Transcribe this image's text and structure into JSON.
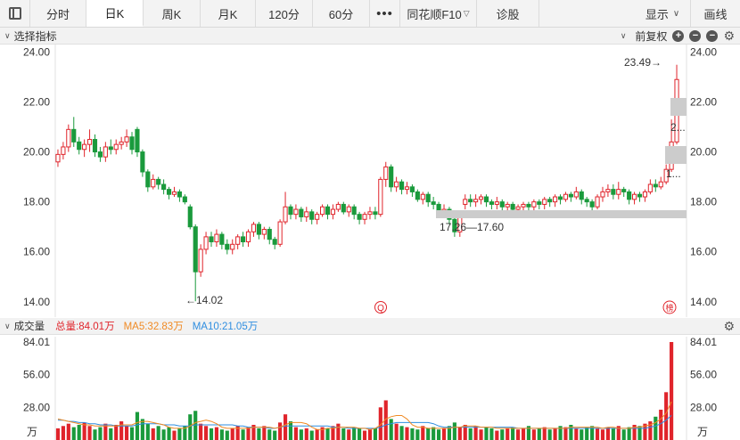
{
  "toolbar": {
    "tabs": [
      "分时",
      "日K",
      "周K",
      "月K",
      "120分",
      "60分"
    ],
    "active_tab": "日K",
    "more": "•••",
    "f10": "同花顺F10",
    "diagnose": "诊股",
    "display": "显示",
    "draw": "画线"
  },
  "indicator_bar": {
    "label": "选择指标",
    "adjust": "前复权"
  },
  "volume_bar": {
    "label": "成交量",
    "total": "总量:84.01万",
    "ma5": "MA5:32.83万",
    "ma10": "MA10:21.05万"
  },
  "colors": {
    "up": "#e0242b",
    "down": "#1a9a3c",
    "ma5": "#f08a24",
    "ma10": "#2f8ee0",
    "band": "#cccccc"
  },
  "annotations": {
    "high": "23.49→",
    "low": "←14.02",
    "range": "17.26—17.60",
    "band_a": "2...",
    "band_b": "1...",
    "marker_q": "Q",
    "marker_bang": "榜"
  },
  "chart_data": {
    "type": "candlestick",
    "price_axis": {
      "ticks": [
        "24.00",
        "22.00",
        "20.00",
        "18.00",
        "16.00",
        "14.00"
      ],
      "range": [
        13.6,
        24.3
      ]
    },
    "volume_axis": {
      "ticks": [
        "84.01",
        "56.00",
        "28.00"
      ],
      "unit": "万",
      "range": [
        0,
        84.01
      ]
    },
    "candles": [
      [
        19.6,
        19.9,
        19.4,
        20.1
      ],
      [
        19.9,
        20.2,
        19.7,
        20.4
      ],
      [
        20.2,
        20.9,
        20.0,
        21.1
      ],
      [
        20.9,
        20.4,
        20.2,
        21.4
      ],
      [
        20.4,
        20.1,
        19.9,
        20.6
      ],
      [
        20.1,
        20.3,
        19.8,
        20.5
      ],
      [
        20.3,
        20.5,
        20.0,
        20.9
      ],
      [
        20.5,
        20.0,
        19.8,
        20.7
      ],
      [
        20.0,
        19.8,
        19.6,
        20.2
      ],
      [
        19.8,
        20.2,
        19.6,
        20.4
      ],
      [
        20.2,
        20.1,
        19.9,
        20.5
      ],
      [
        20.1,
        20.3,
        19.9,
        20.5
      ],
      [
        20.3,
        20.4,
        20.1,
        20.6
      ],
      [
        20.4,
        20.6,
        20.2,
        20.9
      ],
      [
        20.6,
        20.1,
        19.9,
        20.8
      ],
      [
        20.9,
        20.0,
        19.8,
        21.0
      ],
      [
        20.0,
        19.2,
        19.0,
        20.1
      ],
      [
        19.2,
        18.6,
        18.4,
        19.3
      ],
      [
        18.6,
        18.9,
        18.5,
        19.1
      ],
      [
        18.9,
        18.7,
        18.5,
        19.0
      ],
      [
        18.7,
        18.5,
        18.3,
        18.9
      ],
      [
        18.5,
        18.3,
        18.1,
        18.6
      ],
      [
        18.3,
        18.4,
        18.2,
        18.6
      ],
      [
        18.4,
        18.2,
        18.0,
        18.5
      ],
      [
        18.2,
        18.0,
        17.9,
        18.3
      ],
      [
        17.8,
        17.0,
        16.9,
        17.9
      ],
      [
        17.0,
        15.2,
        14.02,
        17.1
      ],
      [
        15.2,
        16.1,
        15.0,
        16.3
      ],
      [
        16.1,
        16.6,
        15.9,
        16.8
      ],
      [
        16.6,
        16.4,
        16.2,
        16.8
      ],
      [
        16.4,
        16.7,
        16.2,
        16.9
      ],
      [
        16.7,
        16.3,
        16.1,
        16.8
      ],
      [
        16.3,
        16.1,
        15.9,
        16.5
      ],
      [
        16.1,
        16.3,
        15.9,
        16.5
      ],
      [
        16.3,
        16.6,
        16.1,
        16.7
      ],
      [
        16.6,
        16.4,
        16.2,
        16.8
      ],
      [
        16.4,
        16.8,
        16.2,
        16.9
      ],
      [
        16.8,
        17.1,
        16.6,
        17.2
      ],
      [
        17.1,
        16.7,
        16.5,
        17.2
      ],
      [
        16.7,
        16.9,
        16.5,
        17.0
      ],
      [
        16.9,
        16.5,
        16.3,
        17.0
      ],
      [
        16.5,
        16.3,
        16.1,
        16.6
      ],
      [
        16.3,
        17.2,
        16.2,
        17.3
      ],
      [
        17.2,
        17.8,
        17.1,
        18.4
      ],
      [
        17.8,
        17.5,
        17.3,
        17.9
      ],
      [
        17.5,
        17.7,
        17.3,
        17.9
      ],
      [
        17.7,
        17.4,
        17.2,
        17.8
      ],
      [
        17.4,
        17.6,
        17.2,
        17.8
      ],
      [
        17.6,
        17.3,
        17.1,
        17.7
      ],
      [
        17.3,
        17.5,
        17.1,
        17.6
      ],
      [
        17.5,
        17.8,
        17.4,
        17.9
      ],
      [
        17.8,
        17.5,
        17.3,
        17.9
      ],
      [
        17.5,
        17.7,
        17.3,
        17.9
      ],
      [
        17.7,
        17.9,
        17.6,
        18.0
      ],
      [
        17.9,
        17.6,
        17.5,
        18.0
      ],
      [
        17.6,
        17.8,
        17.4,
        17.9
      ],
      [
        17.8,
        17.5,
        17.3,
        17.9
      ],
      [
        17.5,
        17.3,
        17.1,
        17.6
      ],
      [
        17.3,
        17.5,
        17.1,
        17.6
      ],
      [
        17.5,
        17.6,
        17.3,
        17.8
      ],
      [
        17.6,
        17.5,
        17.3,
        17.8
      ],
      [
        17.5,
        18.9,
        17.4,
        19.0
      ],
      [
        18.9,
        19.4,
        18.6,
        19.6
      ],
      [
        19.4,
        18.6,
        18.4,
        19.5
      ],
      [
        18.6,
        18.8,
        18.4,
        19.0
      ],
      [
        18.8,
        18.5,
        18.3,
        18.9
      ],
      [
        18.5,
        18.6,
        18.3,
        18.8
      ],
      [
        18.6,
        18.4,
        18.2,
        18.7
      ],
      [
        18.4,
        18.1,
        18.0,
        18.5
      ],
      [
        18.1,
        18.3,
        17.9,
        18.4
      ],
      [
        18.3,
        18.0,
        17.8,
        18.4
      ],
      [
        18.0,
        17.9,
        17.7,
        18.2
      ],
      [
        17.9,
        17.6,
        17.4,
        18.0
      ],
      [
        17.6,
        17.7,
        17.4,
        17.9
      ],
      [
        17.7,
        17.3,
        17.1,
        17.8
      ],
      [
        17.3,
        16.8,
        16.6,
        17.4
      ],
      [
        16.8,
        17.4,
        16.6,
        17.6
      ],
      [
        17.9,
        18.1,
        17.7,
        18.3
      ],
      [
        18.1,
        18.0,
        17.8,
        18.3
      ],
      [
        18.0,
        18.1,
        17.8,
        18.3
      ],
      [
        18.1,
        18.2,
        17.9,
        18.3
      ],
      [
        18.2,
        18.0,
        17.8,
        18.3
      ],
      [
        18.0,
        17.9,
        17.7,
        18.1
      ],
      [
        17.9,
        18.0,
        17.7,
        18.2
      ],
      [
        18.0,
        17.8,
        17.6,
        18.1
      ],
      [
        17.8,
        17.9,
        17.6,
        18.0
      ],
      [
        17.9,
        17.7,
        17.5,
        18.0
      ],
      [
        17.7,
        17.8,
        17.5,
        17.9
      ],
      [
        17.8,
        17.9,
        17.6,
        18.0
      ],
      [
        17.9,
        17.8,
        17.6,
        18.0
      ],
      [
        17.8,
        18.0,
        17.6,
        18.1
      ],
      [
        18.0,
        17.9,
        17.7,
        18.1
      ],
      [
        17.9,
        18.1,
        17.7,
        18.2
      ],
      [
        18.1,
        18.0,
        17.8,
        18.2
      ],
      [
        18.0,
        18.2,
        17.8,
        18.3
      ],
      [
        18.2,
        18.1,
        17.9,
        18.3
      ],
      [
        18.1,
        18.3,
        18.0,
        18.4
      ],
      [
        18.3,
        18.2,
        18.0,
        18.4
      ],
      [
        18.2,
        18.4,
        18.1,
        18.6
      ],
      [
        18.4,
        18.1,
        17.9,
        18.5
      ],
      [
        18.1,
        18.0,
        17.8,
        18.2
      ],
      [
        18.0,
        17.8,
        17.6,
        18.1
      ],
      [
        17.8,
        18.2,
        17.7,
        18.3
      ],
      [
        18.2,
        18.4,
        18.0,
        18.6
      ],
      [
        18.4,
        18.5,
        18.2,
        18.7
      ],
      [
        18.5,
        18.3,
        18.1,
        18.7
      ],
      [
        18.3,
        18.5,
        18.1,
        18.8
      ],
      [
        18.5,
        18.4,
        18.2,
        18.6
      ],
      [
        18.4,
        18.1,
        17.9,
        18.5
      ],
      [
        18.1,
        18.3,
        17.9,
        18.4
      ],
      [
        18.3,
        18.2,
        18.0,
        18.4
      ],
      [
        18.2,
        18.4,
        18.0,
        18.5
      ],
      [
        18.4,
        18.7,
        18.3,
        18.9
      ],
      [
        18.7,
        18.6,
        18.4,
        18.9
      ],
      [
        18.6,
        18.8,
        18.5,
        19.0
      ],
      [
        18.8,
        19.3,
        18.7,
        19.5
      ],
      [
        19.3,
        20.4,
        19.2,
        21.3
      ],
      [
        20.4,
        22.9,
        20.3,
        23.49
      ]
    ],
    "volume": [
      10,
      12,
      14,
      11,
      13,
      15,
      12,
      9,
      11,
      14,
      10,
      13,
      16,
      12,
      11,
      24,
      18,
      14,
      10,
      12,
      9,
      11,
      8,
      10,
      12,
      22,
      25,
      14,
      12,
      10,
      11,
      9,
      8,
      10,
      12,
      9,
      11,
      13,
      10,
      12,
      9,
      8,
      15,
      22,
      16,
      11,
      9,
      10,
      8,
      9,
      11,
      10,
      12,
      14,
      10,
      9,
      11,
      10,
      8,
      9,
      10,
      28,
      34,
      18,
      14,
      12,
      11,
      10,
      9,
      12,
      10,
      11,
      9,
      10,
      12,
      15,
      11,
      13,
      10,
      12,
      9,
      11,
      10,
      8,
      9,
      10,
      11,
      9,
      10,
      12,
      9,
      10,
      11,
      9,
      10,
      12,
      11,
      13,
      10,
      9,
      11,
      12,
      10,
      9,
      11,
      10,
      12,
      9,
      11,
      13,
      12,
      14,
      16,
      20,
      26,
      41,
      84.01
    ],
    "ma5": [
      18,
      17,
      16,
      15,
      14,
      13,
      13,
      12,
      12,
      12,
      12,
      12,
      13,
      13,
      13,
      15,
      16,
      16,
      15,
      14,
      13,
      11,
      10,
      10,
      10,
      12,
      15,
      16,
      17,
      16,
      14,
      11,
      10,
      10,
      10,
      10,
      10,
      11,
      11,
      11,
      11,
      10,
      11,
      13,
      15,
      15,
      15,
      14,
      11,
      9,
      9,
      10,
      10,
      11,
      11,
      11,
      11,
      10,
      10,
      9,
      10,
      13,
      18,
      20,
      21,
      21,
      18,
      13,
      11,
      11,
      10,
      10,
      10,
      10,
      10,
      11,
      11,
      12,
      12,
      12,
      11,
      11,
      11,
      10,
      10,
      10,
      10,
      10,
      10,
      10,
      10,
      10,
      10,
      10,
      10,
      10,
      10,
      11,
      11,
      11,
      11,
      11,
      11,
      10,
      11,
      11,
      10,
      10,
      10,
      11,
      11,
      12,
      13,
      15,
      18,
      23,
      32.83
    ],
    "ma10": [
      17,
      17,
      16,
      16,
      15,
      15,
      14,
      14,
      13,
      13,
      13,
      12,
      12,
      12,
      12,
      13,
      14,
      14,
      14,
      14,
      13,
      13,
      13,
      12,
      12,
      12,
      13,
      13,
      13,
      13,
      13,
      13,
      13,
      13,
      12,
      12,
      11,
      11,
      11,
      11,
      10,
      10,
      11,
      12,
      12,
      12,
      12,
      12,
      12,
      12,
      12,
      12,
      11,
      11,
      11,
      10,
      10,
      10,
      10,
      10,
      10,
      11,
      13,
      14,
      15,
      15,
      15,
      15,
      15,
      15,
      15,
      14,
      12,
      11,
      11,
      11,
      11,
      11,
      11,
      11,
      11,
      11,
      11,
      11,
      11,
      11,
      11,
      10,
      10,
      10,
      10,
      10,
      10,
      10,
      10,
      10,
      10,
      10,
      10,
      10,
      10,
      10,
      10,
      10,
      10,
      10,
      10,
      10,
      10,
      10,
      10,
      10,
      11,
      12,
      14,
      17,
      21.05
    ]
  }
}
